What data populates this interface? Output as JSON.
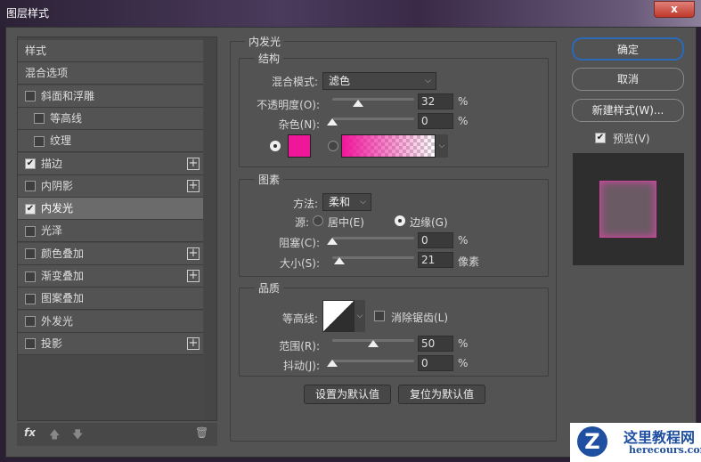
{
  "window": {
    "title": "图层样式",
    "close_label": "x"
  },
  "styles_list": [
    {
      "label": "样式",
      "checkbox": false,
      "checked": false,
      "indent": false,
      "plus": false
    },
    {
      "label": "混合选项",
      "checkbox": false,
      "checked": false,
      "indent": false,
      "plus": false
    },
    {
      "label": "斜面和浮雕",
      "checkbox": true,
      "checked": false,
      "indent": false,
      "plus": false
    },
    {
      "label": "等高线",
      "checkbox": true,
      "checked": false,
      "indent": true,
      "plus": false
    },
    {
      "label": "纹理",
      "checkbox": true,
      "checked": false,
      "indent": true,
      "plus": false
    },
    {
      "label": "描边",
      "checkbox": true,
      "checked": true,
      "indent": false,
      "plus": true
    },
    {
      "label": "内阴影",
      "checkbox": true,
      "checked": false,
      "indent": false,
      "plus": true
    },
    {
      "label": "内发光",
      "checkbox": true,
      "checked": true,
      "indent": false,
      "plus": false,
      "selected": true
    },
    {
      "label": "光泽",
      "checkbox": true,
      "checked": false,
      "indent": false,
      "plus": false
    },
    {
      "label": "颜色叠加",
      "checkbox": true,
      "checked": false,
      "indent": false,
      "plus": true
    },
    {
      "label": "渐变叠加",
      "checkbox": true,
      "checked": false,
      "indent": false,
      "plus": true
    },
    {
      "label": "图案叠加",
      "checkbox": true,
      "checked": false,
      "indent": false,
      "plus": false
    },
    {
      "label": "外发光",
      "checkbox": true,
      "checked": false,
      "indent": false,
      "plus": false
    },
    {
      "label": "投影",
      "checkbox": true,
      "checked": false,
      "indent": false,
      "plus": true
    }
  ],
  "footer": {
    "fx": "fx"
  },
  "panel": {
    "title": "内发光",
    "structure": {
      "title": "结构",
      "blend_label": "混合模式:",
      "blend_value": "滤色",
      "opacity_label": "不透明度(O):",
      "opacity": 32,
      "opacity_unit": "%",
      "noise_label": "杂色(N):",
      "noise": 0,
      "noise_unit": "%",
      "color": "#f0169a"
    },
    "elements": {
      "title": "图素",
      "method_label": "方法:",
      "method_value": "柔和",
      "source_label": "源:",
      "source_center": "居中(E)",
      "source_edge": "边缘(G)",
      "choke_label": "阻塞(C):",
      "choke": 0,
      "choke_unit": "%",
      "size_label": "大小(S):",
      "size": 21,
      "size_unit": "像素"
    },
    "quality": {
      "title": "品质",
      "contour_label": "等高线:",
      "antialias_label": "消除锯齿(L)",
      "range_label": "范围(R):",
      "range": 50,
      "range_unit": "%",
      "jitter_label": "抖动(J):",
      "jitter": 0,
      "jitter_unit": "%"
    },
    "set_default": "设置为默认值",
    "reset_default": "复位为默认值"
  },
  "right": {
    "ok": "确定",
    "cancel": "取消",
    "new_style": "新建样式(W)...",
    "preview_label": "预览(V)",
    "preview_checked": true
  },
  "watermark": {
    "cn": "这里教程网",
    "en": "herecours.com"
  }
}
